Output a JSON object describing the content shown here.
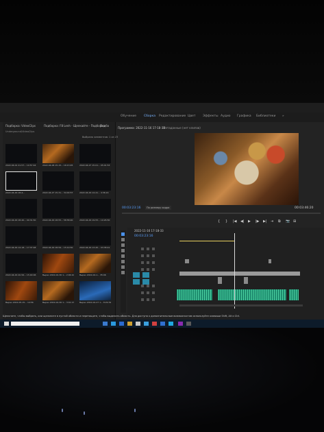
{
  "workspaces": [
    {
      "label": "Обучение",
      "active": false
    },
    {
      "label": "Сборка",
      "active": true
    },
    {
      "label": "Редактирование",
      "active": false
    },
    {
      "label": "Цвет",
      "active": false
    },
    {
      "label": "Эффекты",
      "active": false
    },
    {
      "label": "Аудио",
      "active": false
    },
    {
      "label": "Графика",
      "active": false
    },
    {
      "label": "Библиотеки",
      "active": false
    },
    {
      "label": "»",
      "active": false
    }
  ],
  "project_panel": {
    "tabs": [
      "Подборка: VideoClips",
      "Подборка: F8 Lenh - Щелкайте - Подборка",
      "Подбо"
    ],
    "path": "Underground/VideoClips",
    "status": "Выбрано элементов: 1 из 23",
    "clips": [
      {
        "caption": "2022-04-01 21-57...",
        "duration": "10:57:44",
        "style": "dark"
      },
      {
        "caption": "2022-04-06 15-15...",
        "duration": "16:13:45",
        "style": "warm"
      },
      {
        "caption": "2022-04-27 15-01...",
        "duration": "05:41:53",
        "style": "dark"
      },
      {
        "caption": "2022-04-29 18-4...",
        "duration": "",
        "style": "selected"
      },
      {
        "caption": "2022-04-27 15-31...",
        "duration": "34:00:57",
        "style": "dark"
      },
      {
        "caption": "2022-04-29 14-41...",
        "duration": "4:36:24",
        "style": "dark"
      },
      {
        "caption": "2022-04-29 18-40...",
        "duration": "00:31:50",
        "style": "dark"
      },
      {
        "caption": "2022-04-29 18-55...",
        "duration": "58:58:40",
        "style": "dark"
      },
      {
        "caption": "2022-04-29 19-55...",
        "duration": "10:26:50",
        "style": "dark"
      },
      {
        "caption": "2022-04-29 14-18...",
        "duration": "17:37:48",
        "style": "dark"
      },
      {
        "caption": "2022-04-29 18-59...",
        "duration": "15:19:50",
        "style": "dark"
      },
      {
        "caption": "2022-04-29 13-45...",
        "duration": "03:38:41",
        "style": "dark"
      },
      {
        "caption": "2022-04-29 20-56...",
        "duration": "15:00:06",
        "style": "dark"
      },
      {
        "caption": "Вырез 2022-04-30 1...",
        "duration": "2:06:10:53",
        "style": "orange"
      },
      {
        "caption": "Вырез 2022-04-1...",
        "duration": "35:06",
        "style": "warm"
      },
      {
        "caption": "Вырез 2022-05-15...",
        "duration": "14:56",
        "style": "orange"
      },
      {
        "caption": "Вырез 2022-04-30 1...",
        "duration": "3:41:17",
        "style": "warm"
      },
      {
        "caption": "Вырез 2022-04-27 1...",
        "duration": "8:29:32",
        "style": "blue"
      }
    ]
  },
  "program_monitor": {
    "title": "Программа: 2022-11-16 17-18-33",
    "secondary_tab": "Метаданные (нет клипов)",
    "timecode_left": "00:03:23:16",
    "timecode_right": "00:03:46:20",
    "fit": "По размеру кадра",
    "transport": [
      "{",
      "}",
      "|◀",
      "◀|",
      "▶",
      "|▶",
      "▶|",
      "⇥",
      "⧉",
      "📷",
      "⊞"
    ]
  },
  "timeline": {
    "sequence_tab": "2022-11-16 17-18-33",
    "timecode": "00:03:23:16",
    "video_tracks": [
      "V3",
      "V2",
      "V1"
    ],
    "audio_tracks": [
      "A1",
      "A2",
      "A3"
    ]
  },
  "taskbar": {
    "notice": "Щелкните, чтобы выбрать, или щелкните в пустой области и перетащите, чтобы выделить область. Для доступа к дополнительным возможностям используйте клавиши Shift, Alt и Ctrl."
  },
  "colors": {
    "accent_blue": "#5aa0ff",
    "audio_clip": "#4ad0a0",
    "track_button": "#2a8aa8",
    "yellow_work_area": "#e8d060"
  }
}
